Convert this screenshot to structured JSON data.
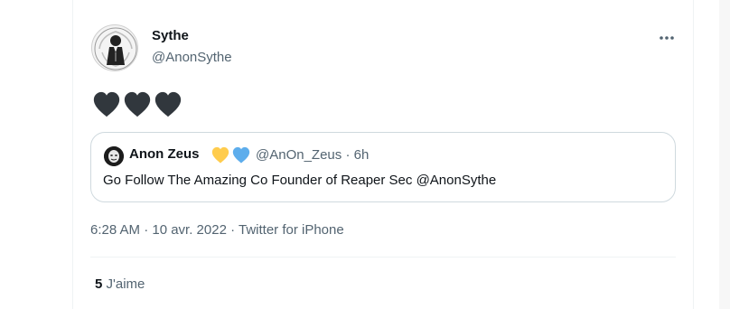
{
  "tweet": {
    "author_name": "Sythe",
    "author_handle": "@AnonSythe",
    "body_emoji": [
      "black-heart",
      "black-heart",
      "black-heart"
    ],
    "more_icon": "more-dots-icon",
    "timestamp": "6:28 AM · 10 avr. 2022 · Twitter for iPhone",
    "likes_count": "5",
    "likes_label": "J'aime"
  },
  "quote": {
    "author_name": "Anon Zeus",
    "badges": [
      "yellow-heart",
      "blue-heart"
    ],
    "author_handle": "@AnOn_Zeus · 6h",
    "text": "Go Follow The Amazing Co Founder of Reaper Sec @AnonSythe"
  },
  "colors": {
    "text_primary": "#0f1419",
    "text_secondary": "#536471",
    "border": "#cfd9de",
    "divider": "#eff3f4",
    "heart_yellow": "#ffcc4d",
    "heart_blue": "#5dadec",
    "heart_black": "#31373d"
  }
}
